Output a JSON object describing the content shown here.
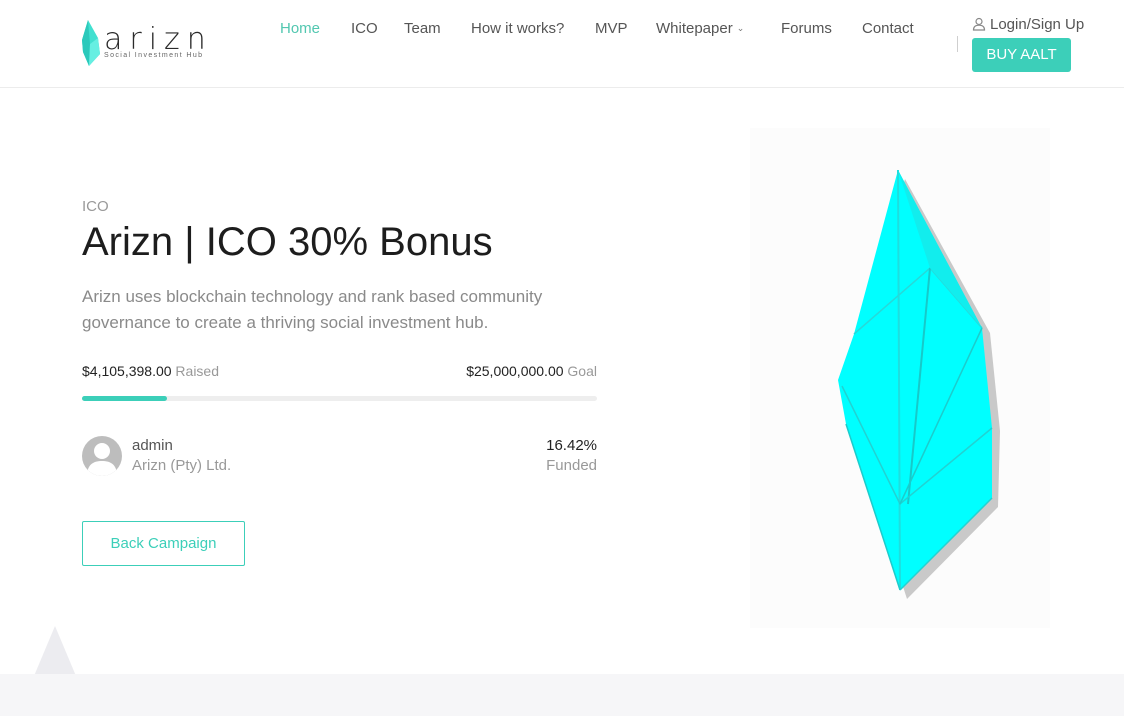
{
  "header": {
    "logo_word": "arizn",
    "logo_tagline": "Social Investment Hub",
    "nav": [
      {
        "label": "Home",
        "active": true
      },
      {
        "label": "ICO",
        "active": false
      },
      {
        "label": "Team",
        "active": false
      },
      {
        "label": "How it works?",
        "active": false
      },
      {
        "label": "MVP",
        "active": false
      },
      {
        "label": "Whitepaper",
        "active": false,
        "dropdown": true
      },
      {
        "label": "Forums",
        "active": false
      },
      {
        "label": "Contact",
        "active": false
      }
    ],
    "login_label": "Login/Sign Up",
    "buy_label": "BUY AALT"
  },
  "hero": {
    "category": "ICO",
    "title": "Arizn | ICO 30% Bonus",
    "description": "Arizn uses blockchain technology and rank based community governance to create a thriving social investment hub.",
    "raised_amount": "$4,105,398.00",
    "raised_label": "Raised",
    "goal_amount": "$25,000,000.00",
    "goal_label": "Goal",
    "progress_fraction": 0.1642,
    "author_name": "admin",
    "author_org": "Arizn (Pty) Ltd.",
    "funded_percent": "16.42%",
    "funded_label": "Funded",
    "back_button": "Back Campaign"
  },
  "colors": {
    "accent": "#3ccfb9",
    "nav_active": "#52c7b0",
    "origami": "#00ffff"
  },
  "icons": {
    "user": "user-icon",
    "chevron": "chevron-down-icon",
    "logo": "origami-leaf-icon"
  }
}
